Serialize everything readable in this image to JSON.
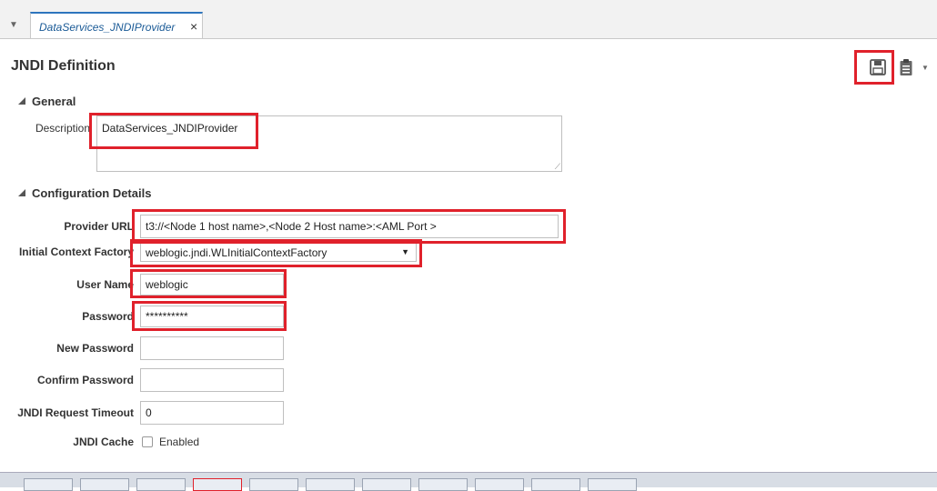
{
  "tabbar": {
    "tab_title": "DataServices_JNDIProvider",
    "close_glyph": "×",
    "menu_glyph": "▼"
  },
  "page": {
    "title": "JNDI Definition"
  },
  "toolbar": {
    "save_icon": "save-icon",
    "clipboard_icon": "clipboard-icon",
    "dropdown_glyph": "▼"
  },
  "general": {
    "header": "General",
    "description_label": "Description",
    "description_value": "DataServices_JNDIProvider"
  },
  "config": {
    "header": "Configuration Details",
    "provider_url_label": "Provider URL",
    "provider_url_value": "t3://<Node 1 host name>,<Node 2 Host name>:<AML Port  >",
    "initial_context_label": "Initial Context Factory",
    "initial_context_value": "weblogic.jndi.WLInitialContextFactory",
    "user_name_label": "User Name",
    "user_name_value": "weblogic",
    "password_label": "Password",
    "password_value": "**********",
    "new_password_label": "New Password",
    "new_password_value": "",
    "confirm_password_label": "Confirm Password",
    "confirm_password_value": "",
    "timeout_label": "JNDI Request Timeout",
    "timeout_value": "0",
    "cache_label": "JNDI Cache",
    "cache_checkbox_label": "Enabled",
    "cache_enabled": false
  },
  "colors": {
    "highlight": "#e0212b",
    "tab_accent": "#2d75bd",
    "tab_text": "#1a5a96"
  }
}
